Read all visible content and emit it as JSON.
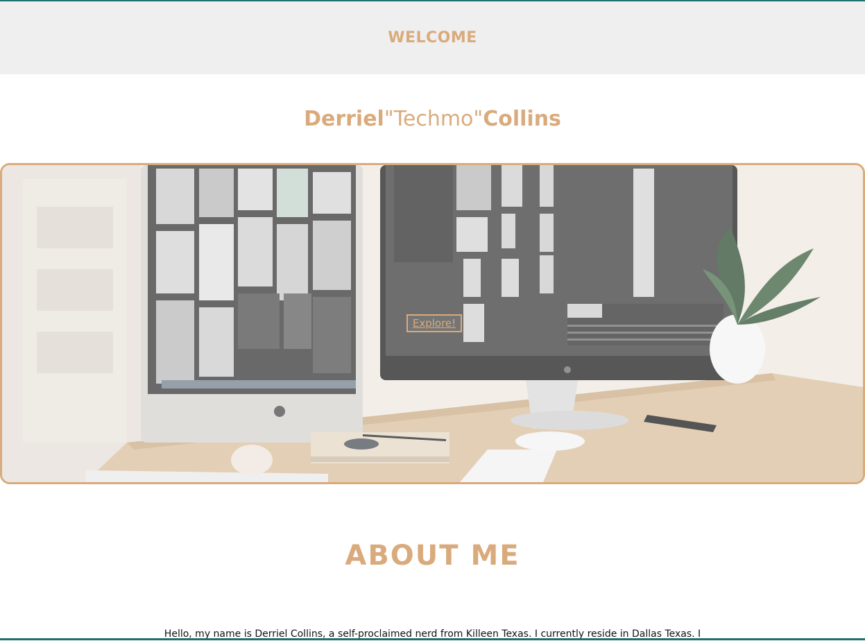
{
  "header": {
    "welcome": "WELCOME"
  },
  "title": {
    "first": "Derriel",
    "nickname": "\"Techmo\"",
    "last": "Collins"
  },
  "hero": {
    "button_label": "Explore!"
  },
  "about": {
    "heading": "ABOUT ME",
    "text": "Hello, my name is Derriel Collins, a self-proclaimed nerd from Killeen Texas. I currently reside in Dallas Texas. I"
  },
  "colors": {
    "accent": "#d9ab7c",
    "header_bg": "#efefef",
    "top_border": "#1f6f6a"
  }
}
